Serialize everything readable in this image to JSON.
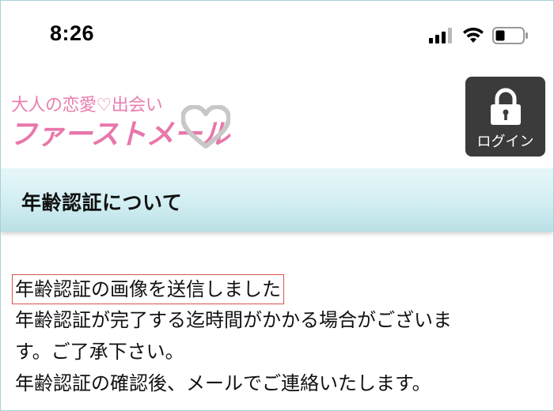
{
  "status_bar": {
    "time": "8:26"
  },
  "header": {
    "logo": {
      "tagline": "大人の恋愛♡出会い",
      "brand": "ファーストメール"
    },
    "login_button": {
      "label": "ログイン",
      "icon": "lock-icon"
    }
  },
  "section": {
    "title": "年齢認証について"
  },
  "message": {
    "highlight": "年齢認証の画像を送信しました",
    "lines": [
      "年齢認証が完了する迄時間がかかる場合がございま",
      "す。ご了承下さい。",
      "年齢認証の確認後、メールでご連絡いたします。"
    ]
  },
  "colors": {
    "brand_pink": "#e877ab",
    "band_teal": "#d2eef2",
    "login_bg": "#3b3b3b",
    "highlight_border": "#d9534f"
  }
}
